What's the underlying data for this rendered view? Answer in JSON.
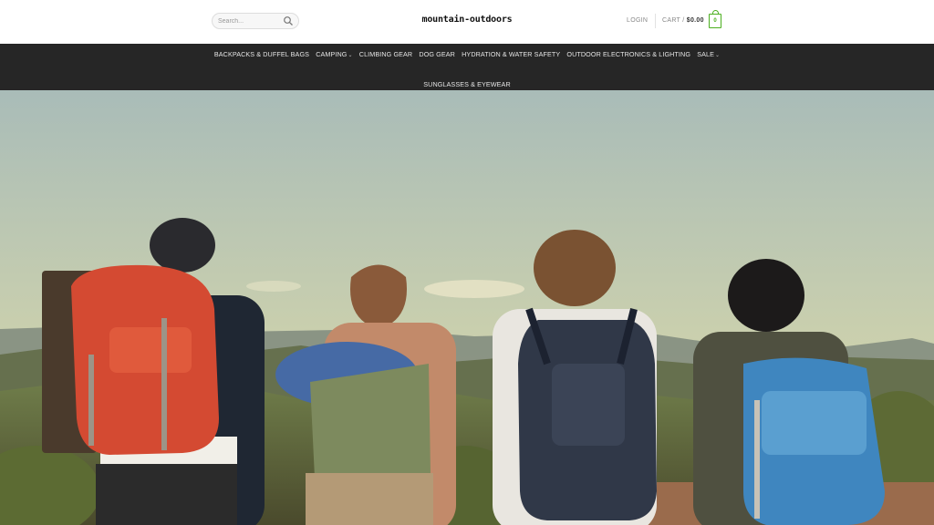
{
  "search": {
    "placeholder": "Search..."
  },
  "logo": {
    "text": "mountain-outdoors"
  },
  "account": {
    "login_label": "LOGIN"
  },
  "cart": {
    "label": "CART /",
    "total": "$0.00",
    "count": "0"
  },
  "nav": {
    "items": [
      {
        "label": "BACKPACKS & DUFFEL BAGS",
        "has_dropdown": false
      },
      {
        "label": "CAMPING",
        "has_dropdown": true
      },
      {
        "label": "CLIMBING GEAR",
        "has_dropdown": false
      },
      {
        "label": "DOG GEAR",
        "has_dropdown": false
      },
      {
        "label": "HYDRATION & WATER SAFETY",
        "has_dropdown": false
      },
      {
        "label": "OUTDOOR ELECTRONICS & LIGHTING",
        "has_dropdown": false
      },
      {
        "label": "SALE",
        "has_dropdown": true
      }
    ],
    "row2": [
      {
        "label": "SUNGLASSES & EYEWEAR",
        "has_dropdown": false
      }
    ]
  },
  "colors": {
    "accent": "#4caf1f",
    "nav_bg": "#262626",
    "sky_top": "#aebfb9",
    "sky_bottom": "#d7d6a6"
  }
}
